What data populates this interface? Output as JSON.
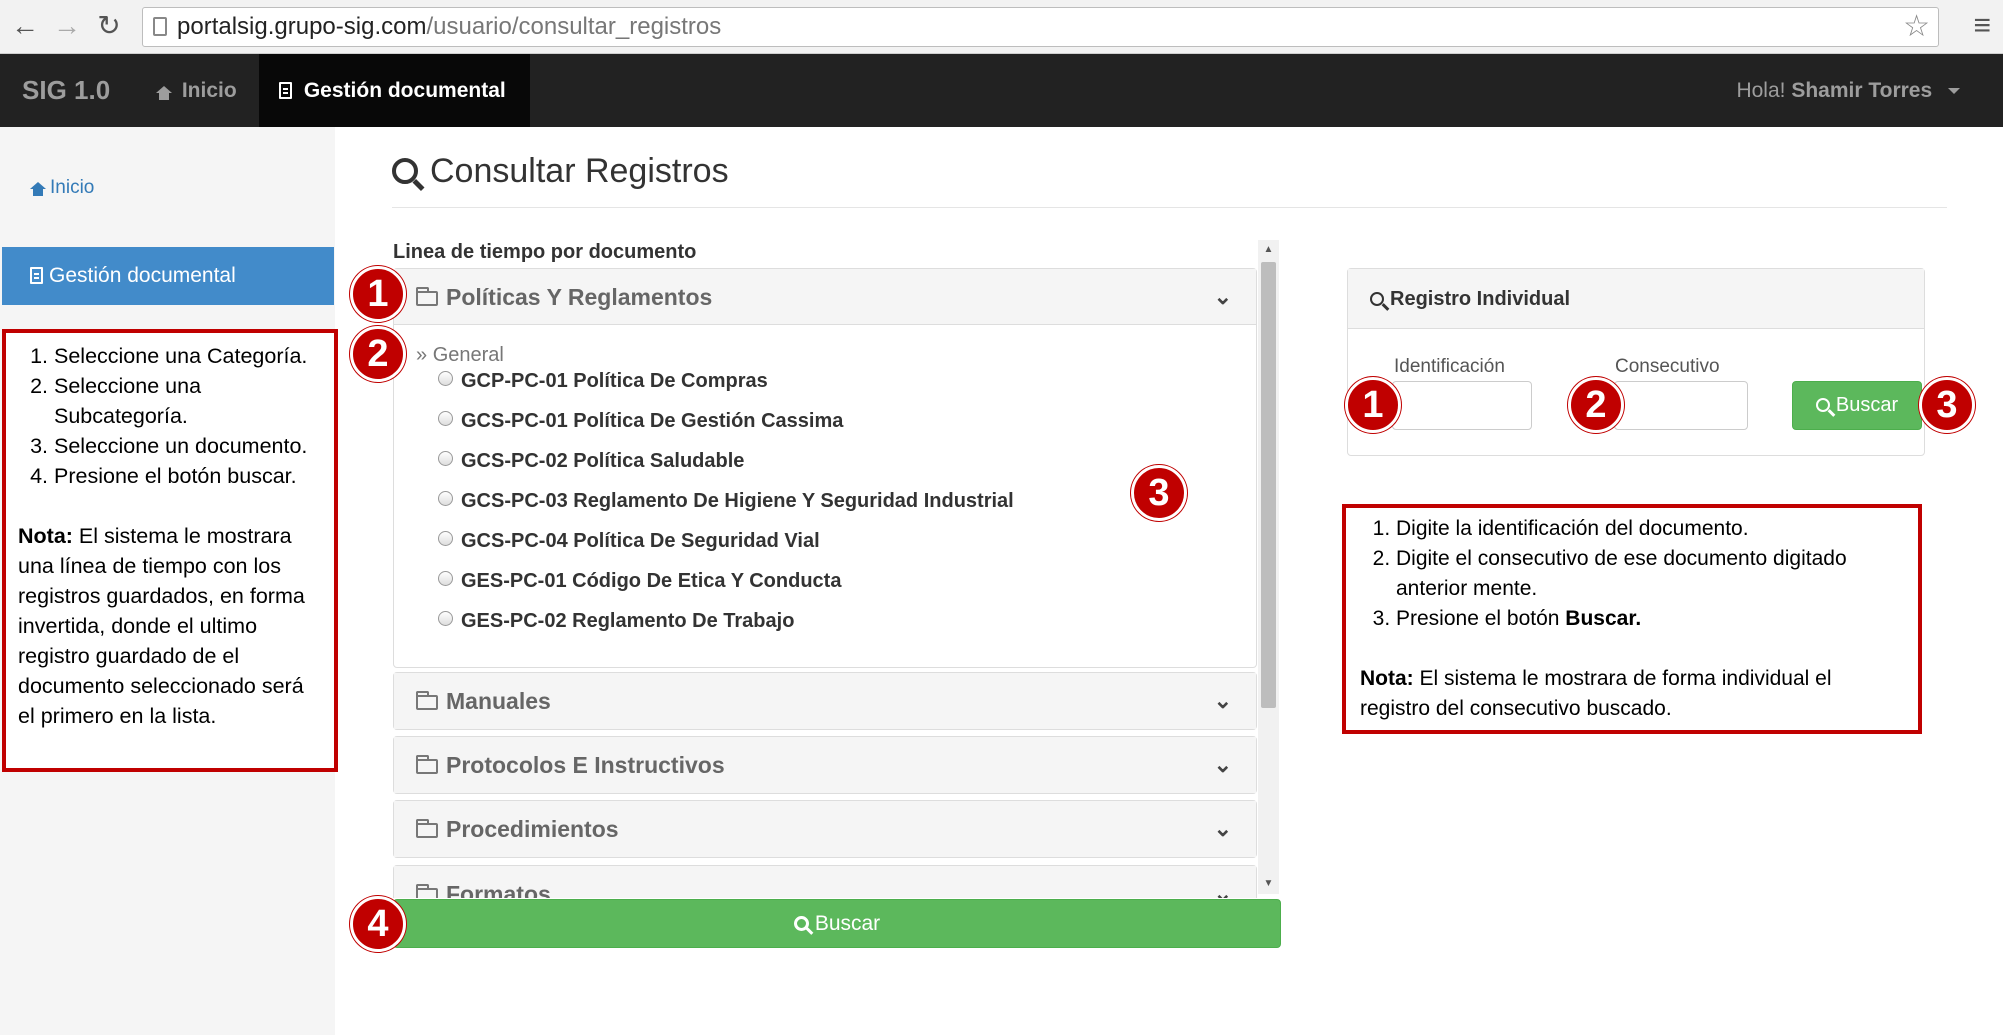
{
  "browser": {
    "url_host": "portalsig.grupo-sig.com",
    "url_path": "/usuario/consultar_registros"
  },
  "navbar": {
    "brand": "SIG 1.0",
    "inicio": "Inicio",
    "gestion": "Gestión documental",
    "greeting": "Hola!",
    "user_name": "Shamir Torres"
  },
  "sidebar": {
    "inicio": "Inicio",
    "gestion": "Gestión documental"
  },
  "left_note": {
    "steps": [
      "Seleccione una Categoría.",
      "Seleccione una Subcategoría.",
      "Seleccione un documento.",
      "Presione el botón buscar."
    ],
    "nota_label": "Nota:",
    "nota_text": " El sistema le mostrara una línea de tiempo con los registros guardados, en forma invertida, donde el ultimo registro guardado de el documento seleccionado será el primero en la lista."
  },
  "main": {
    "title": "Consultar Registros",
    "timeline_label": "Linea de tiempo por documento",
    "categories": [
      "Políticas Y Reglamentos",
      "Manuales",
      "Protocolos E Instructivos",
      "Procedimientos",
      "Formatos"
    ],
    "subcategory": "General",
    "documents": [
      "GCP-PC-01 Política De Compras",
      "GCS-PC-01 Política De Gestión Cassima",
      "GCS-PC-02 Política Saludable",
      "GCS-PC-03 Reglamento De Higiene Y Seguridad Industrial",
      "GCS-PC-04 Política De Seguridad Vial",
      "GES-PC-01 Código De Etica Y Conducta",
      "GES-PC-02 Reglamento De Trabajo"
    ],
    "search_button": "Buscar"
  },
  "registro_individual": {
    "title": "Registro Individual",
    "id_label": "Identificación",
    "cons_label": "Consecutivo",
    "id_value": "",
    "cons_value": "",
    "button": "Buscar"
  },
  "right_note": {
    "step1": "Digite la identificación del documento.",
    "step2": "Digite el consecutivo de ese documento digitado anterior mente.",
    "step3_text": "Presione el botón ",
    "step3_bold": "Buscar.",
    "nota_label": "Nota:",
    "nota_text": " El sistema le mostrara de forma individual el registro del consecutivo buscado."
  },
  "markers": [
    "1",
    "2",
    "3",
    "4"
  ],
  "colors": {
    "accent": "#428bca",
    "success": "#5cb85c",
    "navbar": "#222222",
    "annotation": "#c00000"
  }
}
